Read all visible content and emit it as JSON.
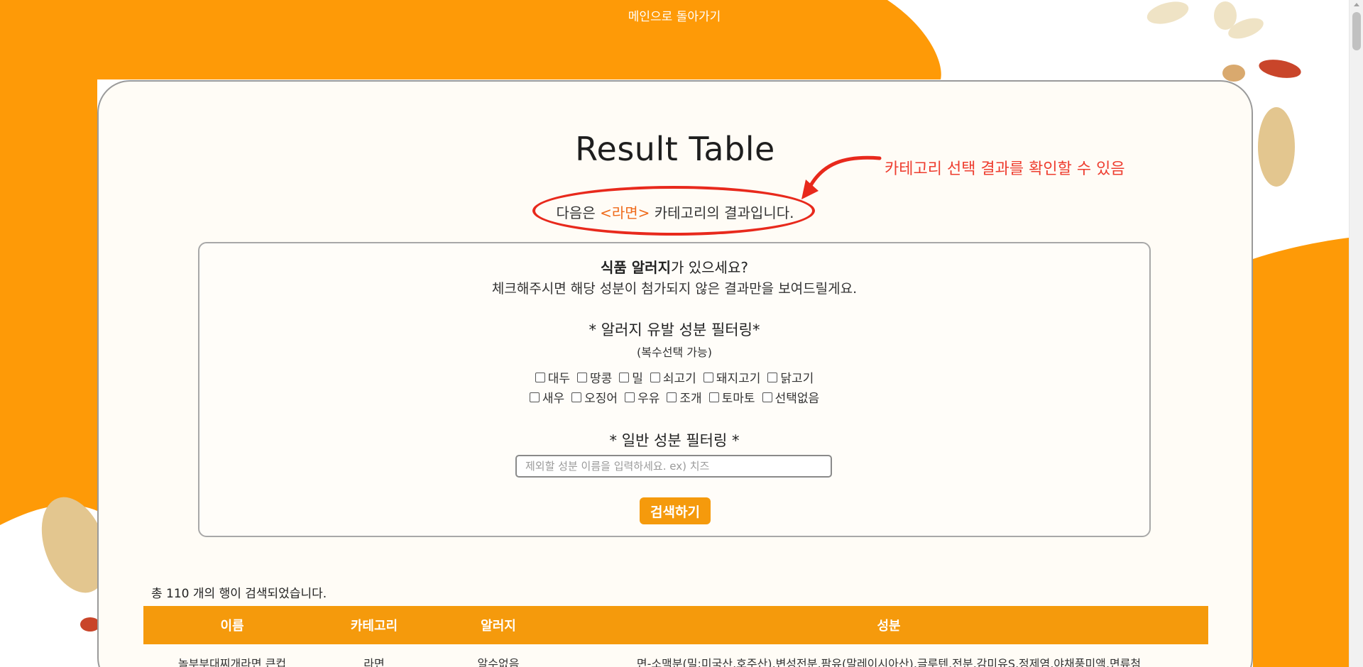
{
  "nav": {
    "back_label": "메인으로 돌아가기"
  },
  "page": {
    "title": "Result Table"
  },
  "category_line": {
    "prefix": "다음은 ",
    "category": "<라면>",
    "suffix": " 카테고리의 결과입니다."
  },
  "annotation": {
    "text": "카테고리 선택 결과를 확인할 수 있음",
    "color": "#ee3d2f"
  },
  "filter": {
    "question_bold": "식품 알러지",
    "question_rest": "가 있으세요?",
    "description": "체크해주시면 해당 성분이 첨가되지 않은 결과만을 보여드릴게요.",
    "allergy_title": "* 알러지 유발 성분 필터링*",
    "allergy_subtitle": "(복수선택 가능)",
    "allergens_row1": [
      "대두",
      "땅콩",
      "밀",
      "쇠고기",
      "돼지고기",
      "닭고기"
    ],
    "allergens_row2": [
      "새우",
      "오징어",
      "우유",
      "조개",
      "토마토",
      "선택없음"
    ],
    "general_title": "* 일반 성분 필터링 *",
    "general_placeholder": "제외할 성분 이름을 입력하세요. ex) 치즈",
    "search_label": "검색하기"
  },
  "results": {
    "count_text": "총 110 개의 행이 검색되었습니다.",
    "columns": [
      "이름",
      "카테고리",
      "알러지",
      "성분"
    ],
    "rows": [
      {
        "name": "놀부부대찌개라면 큰컵",
        "category": "라면",
        "allergy": "알수없음",
        "ingredients": "면-소맥분(밀:미국산,호주산),변성전분,팜유(말레이시아산),글루텐,전분,감미유S,정제염,야채풍미액,면류첨"
      }
    ]
  },
  "colors": {
    "accent": "#f59a0c",
    "category_highlight": "#ef6a1a",
    "background_orange": "#fe9a07"
  }
}
